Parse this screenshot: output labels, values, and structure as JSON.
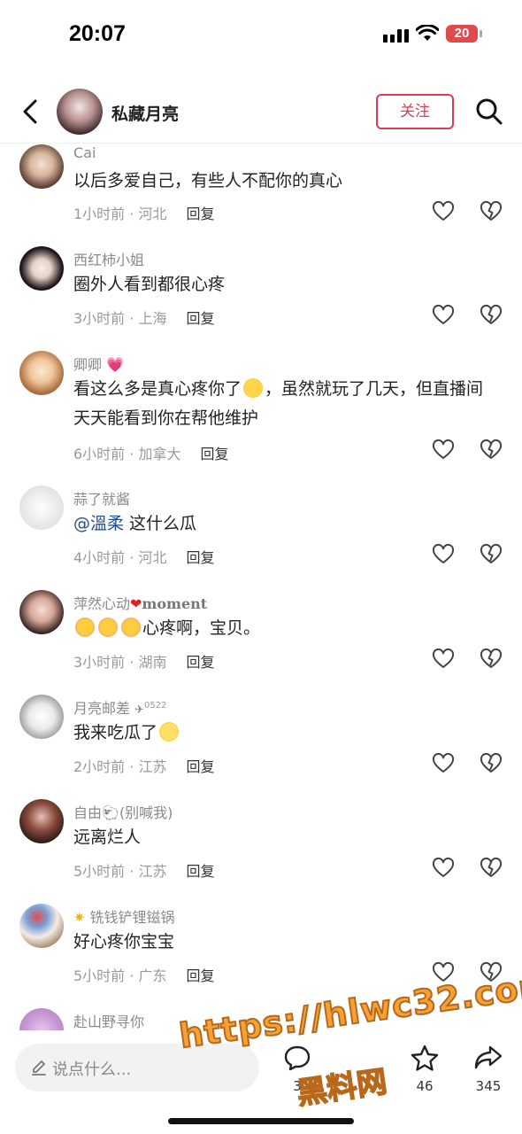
{
  "status_bar": {
    "time": "20:07",
    "battery": "20"
  },
  "header": {
    "username": "私藏月亮",
    "follow_label": "关注"
  },
  "comments": [
    {
      "name": "Cai",
      "text": "以后多爱自己，有些人不配你的真心",
      "time_location": "1小时前 · 河北",
      "reply_label": "回复"
    },
    {
      "name": "西红柿小姐",
      "text": "圈外人看到都很心疼",
      "time_location": "3小时前 · 上海",
      "reply_label": "回复"
    },
    {
      "name": "卿卿",
      "text_before_emoji": "看这么多是真心疼你了",
      "text_after_emoji": "，虽然就玩了几天，但直播间天天能看到你在帮他维护",
      "time_location": "6小时前 · 加拿大",
      "reply_label": "回复"
    },
    {
      "name": "蒜了就酱",
      "mention": "@溫柔",
      "text": " 这什么瓜",
      "time_location": "4小时前 · 河北",
      "reply_label": "回复"
    },
    {
      "name": "萍然心动",
      "name_suffix": "moment",
      "text": "心疼啊，宝贝。",
      "time_location": "3小时前 · 湖南",
      "reply_label": "回复"
    },
    {
      "name": "月亮邮差",
      "name_suffix": "0522",
      "text": "我来吃瓜了",
      "time_location": "2小时前 · 江苏",
      "reply_label": "回复"
    },
    {
      "name": "自由",
      "name_suffix": "(别喊我)",
      "text": "远离烂人",
      "time_location": "5小时前 · 江苏",
      "reply_label": "回复"
    },
    {
      "name": "铣钱铲锂镃锅",
      "text": "好心疼你宝宝",
      "time_location": "5小时前 · 广东",
      "reply_label": "回复"
    },
    {
      "name": "赴山野寻你"
    }
  ],
  "bottom_bar": {
    "input_placeholder": "说点什么...",
    "comment_count": "3",
    "star_count": "46",
    "share_count": "345"
  },
  "watermark": {
    "line1": "https://hlwc32.com",
    "line2": "黑料网"
  },
  "colors": {
    "accent": "#e03a55",
    "mention": "#1e4e92",
    "watermark": "#f4a235"
  },
  "icons": [
    "back-arrow-icon",
    "search-icon",
    "heart-icon",
    "broken-heart-icon",
    "pencil-icon",
    "comment-icon",
    "star-icon",
    "share-icon"
  ]
}
